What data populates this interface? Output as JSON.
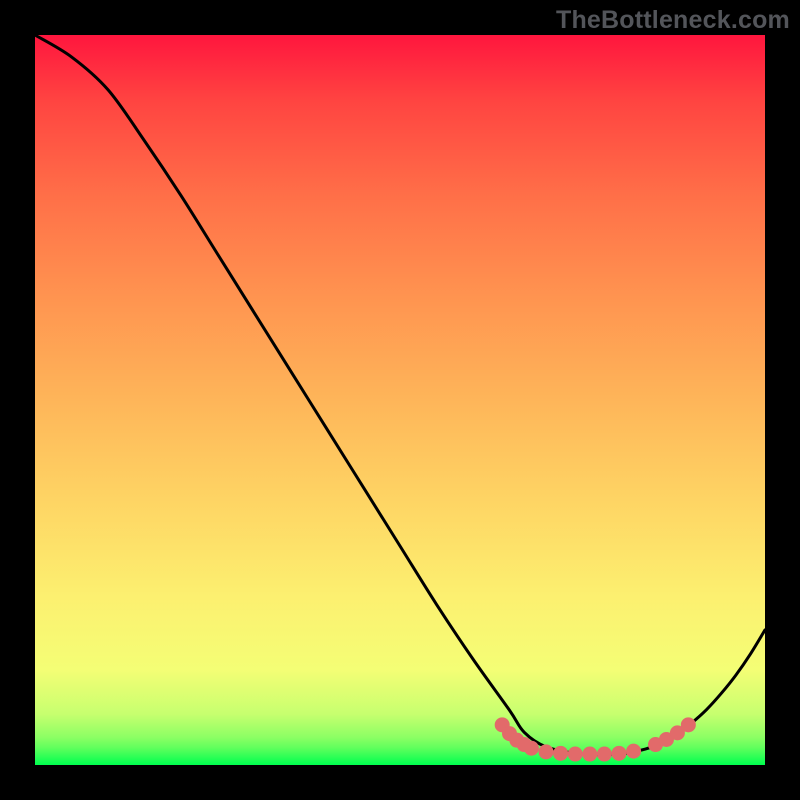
{
  "watermark": "TheBottleneck.com",
  "chart_data": {
    "type": "line",
    "title": "",
    "xlabel": "",
    "ylabel": "",
    "xlim": [
      0,
      100
    ],
    "ylim": [
      0,
      100
    ],
    "grid": false,
    "series": [
      {
        "name": "bottleneck-curve",
        "color": "#000000",
        "x": [
          0,
          5,
          10,
          15,
          20,
          25,
          30,
          35,
          40,
          45,
          50,
          55,
          60,
          65,
          67,
          70,
          75,
          80,
          82,
          84,
          86,
          88,
          90,
          92,
          94,
          96,
          98,
          100
        ],
        "y": [
          100,
          97,
          92.5,
          85.5,
          78,
          70,
          62,
          54,
          46,
          38,
          30,
          22,
          14.5,
          7.5,
          4.5,
          2.5,
          1.5,
          1.5,
          1.8,
          2.3,
          3.1,
          4.3,
          5.8,
          7.6,
          9.8,
          12.3,
          15.2,
          18.5
        ]
      }
    ],
    "markers": [
      {
        "name": "flat-region-dots",
        "color": "#e26a6a",
        "points": [
          {
            "x": 64,
            "y": 5.5
          },
          {
            "x": 65,
            "y": 4.3
          },
          {
            "x": 66,
            "y": 3.4
          },
          {
            "x": 67,
            "y": 2.8
          },
          {
            "x": 68,
            "y": 2.3
          },
          {
            "x": 70,
            "y": 1.8
          },
          {
            "x": 72,
            "y": 1.6
          },
          {
            "x": 74,
            "y": 1.5
          },
          {
            "x": 76,
            "y": 1.5
          },
          {
            "x": 78,
            "y": 1.5
          },
          {
            "x": 80,
            "y": 1.6
          },
          {
            "x": 82,
            "y": 1.9
          },
          {
            "x": 85,
            "y": 2.8
          },
          {
            "x": 86.5,
            "y": 3.5
          },
          {
            "x": 88,
            "y": 4.4
          },
          {
            "x": 89.5,
            "y": 5.5
          }
        ]
      }
    ]
  }
}
